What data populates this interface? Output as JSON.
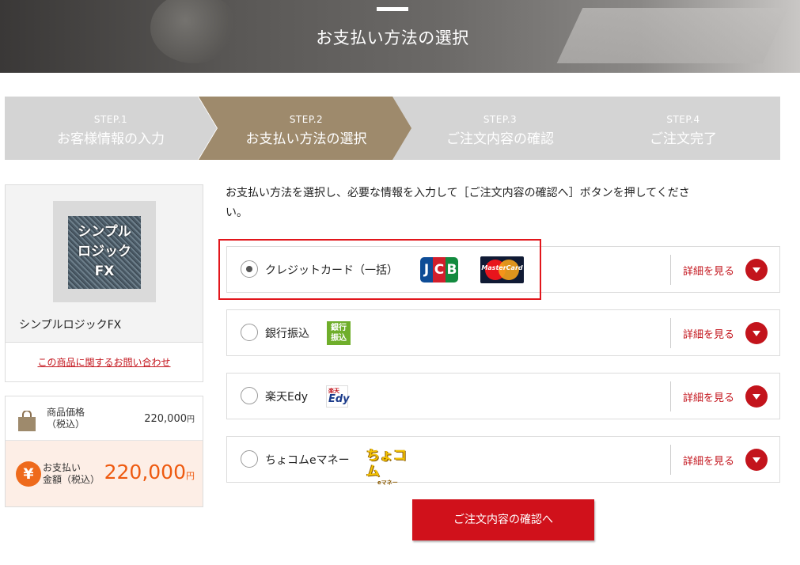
{
  "header": {
    "title": "お支払い方法の選択"
  },
  "steps": [
    {
      "num": "STEP.1",
      "name": "お客様情報の入力",
      "active": false
    },
    {
      "num": "STEP.2",
      "name": "お支払い方法の選択",
      "active": true
    },
    {
      "num": "STEP.3",
      "name": "ご注文内容の確認",
      "active": false
    },
    {
      "num": "STEP.4",
      "name": "ご注文完了",
      "active": false
    }
  ],
  "product": {
    "thumbnail_text": [
      "シンプル",
      "ロジック",
      "FX"
    ],
    "name": "シンプルロジックFX",
    "inquiry_link": "この商品に関するお問い合わせ"
  },
  "price": {
    "item_label_line1": "商品価格",
    "item_label_line2": "（税込）",
    "item_value": "220,000",
    "item_unit": "円",
    "total_label_line1": "お支払い",
    "total_label_line2": "金額（税込）",
    "total_value": "220,000",
    "total_unit": "円",
    "yen_symbol": "¥"
  },
  "instructions": "お支払い方法を選択し、必要な情報を入力して［ご注文内容の確認へ］ボタンを押してください。",
  "payment_methods": [
    {
      "label": "クレジットカード（一括）",
      "selected": true,
      "detail": "詳細を見る"
    },
    {
      "label": "銀行振込",
      "selected": false,
      "detail": "詳細を見る"
    },
    {
      "label": "楽天Edy",
      "selected": false,
      "detail": "詳細を見る"
    },
    {
      "label": "ちょコムeマネー",
      "selected": false,
      "detail": "詳細を見る"
    }
  ],
  "logos": {
    "jcb": [
      "J",
      "C",
      "B"
    ],
    "mastercard": "MasterCard",
    "bank_line1": "銀行",
    "bank_line2": "振込",
    "edy_top": "楽天",
    "edy_main": "Edy",
    "chocom_main": "ちょコム",
    "chocom_sub": "eマネー"
  },
  "confirm_button": "ご注文内容の確認へ",
  "colors": {
    "accent_red": "#c3141c",
    "step_active": "#9e8a6c",
    "step_inactive": "#d4d4d4",
    "price_orange": "#ee5a10"
  }
}
